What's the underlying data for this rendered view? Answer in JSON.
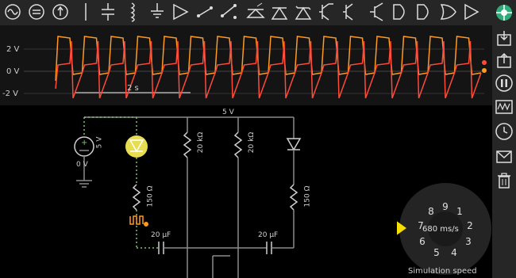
{
  "scope": {
    "y_labels": [
      "2 V",
      "0 V",
      "-2 V"
    ],
    "time_label": "2 s",
    "trace_colors": {
      "trace1": "#ff9a1f",
      "trace2": "#ff4a3a"
    }
  },
  "circuit": {
    "supply_label": "5 V",
    "source_voltage": "5 V",
    "source_ground": "0 V",
    "resistor_left": "20 kΩ",
    "resistor_mid": "20 kΩ",
    "resistor_led_left": "150 Ω",
    "resistor_led_right": "150 Ω",
    "cap_left": "20 μF",
    "cap_right": "20 μF"
  },
  "dial": {
    "numbers": [
      "1",
      "2",
      "3",
      "4",
      "5",
      "6",
      "7",
      "8",
      "9"
    ],
    "readout": "680 ms/s",
    "label": "Simulation speed"
  },
  "toolbar_icons": [
    "ac-source-icon",
    "ground-source-icon",
    "voltage-source-icon",
    "wire-icon",
    "capacitor-icon",
    "inductor-icon",
    "ground-icon",
    "diode-icon",
    "switch-icon",
    "spdt-switch-icon",
    "led-icon",
    "zener-icon",
    "npn-transistor-icon",
    "pnp-transistor-icon",
    "mosfet-icon",
    "logic-gate-icon",
    "and-gate-icon",
    "buffer-icon"
  ],
  "sidebar_icons": [
    "import-icon",
    "export-icon",
    "pause-icon",
    "scope-icon",
    "clock-icon",
    "mail-icon",
    "trash-icon"
  ]
}
